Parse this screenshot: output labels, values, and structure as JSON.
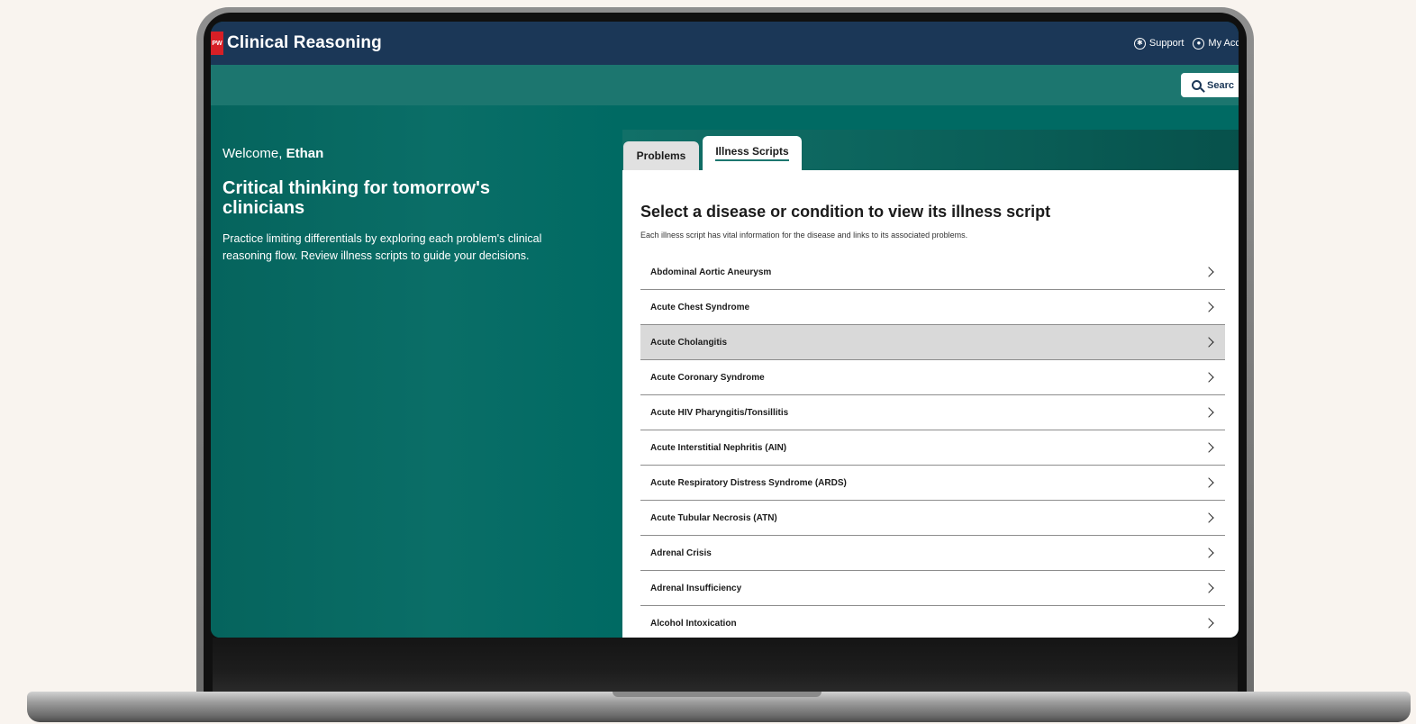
{
  "app": {
    "logo_text": "PW",
    "title": "Clinical Reasoning"
  },
  "header": {
    "support_label": "Support",
    "account_label": "My Acco"
  },
  "search": {
    "label": "Searc"
  },
  "welcome": {
    "greeting": "Welcome, ",
    "user_name": "Ethan"
  },
  "hero": {
    "tagline": "Critical thinking for tomorrow's clinicians",
    "description": "Practice limiting differentials by exploring each problem's clinical reasoning flow. Review illness scripts to guide your decisions."
  },
  "tabs": [
    {
      "label": "Problems",
      "active": false
    },
    {
      "label": "Illness Scripts",
      "active": true
    }
  ],
  "illness_scripts": {
    "title": "Select a disease or condition to view its illness script",
    "subtitle": "Each illness script has vital information for the disease and links to its associated problems.",
    "items": [
      {
        "label": "Abdominal Aortic Aneurysm",
        "highlighted": false
      },
      {
        "label": "Acute Chest Syndrome",
        "highlighted": false
      },
      {
        "label": "Acute Cholangitis",
        "highlighted": true
      },
      {
        "label": "Acute Coronary Syndrome",
        "highlighted": false
      },
      {
        "label": "Acute HIV Pharyngitis/Tonsillitis",
        "highlighted": false
      },
      {
        "label": "Acute Interstitial Nephritis (AIN)",
        "highlighted": false
      },
      {
        "label": "Acute Respiratory Distress Syndrome (ARDS)",
        "highlighted": false
      },
      {
        "label": "Acute Tubular Necrosis (ATN)",
        "highlighted": false
      },
      {
        "label": "Adrenal Crisis",
        "highlighted": false
      },
      {
        "label": "Adrenal Insufficiency",
        "highlighted": false
      },
      {
        "label": "Alcohol Intoxication",
        "highlighted": false
      }
    ]
  },
  "colors": {
    "header_bg": "#1b3757",
    "accent_teal": "#006a63",
    "brand_red": "#d71f26"
  }
}
